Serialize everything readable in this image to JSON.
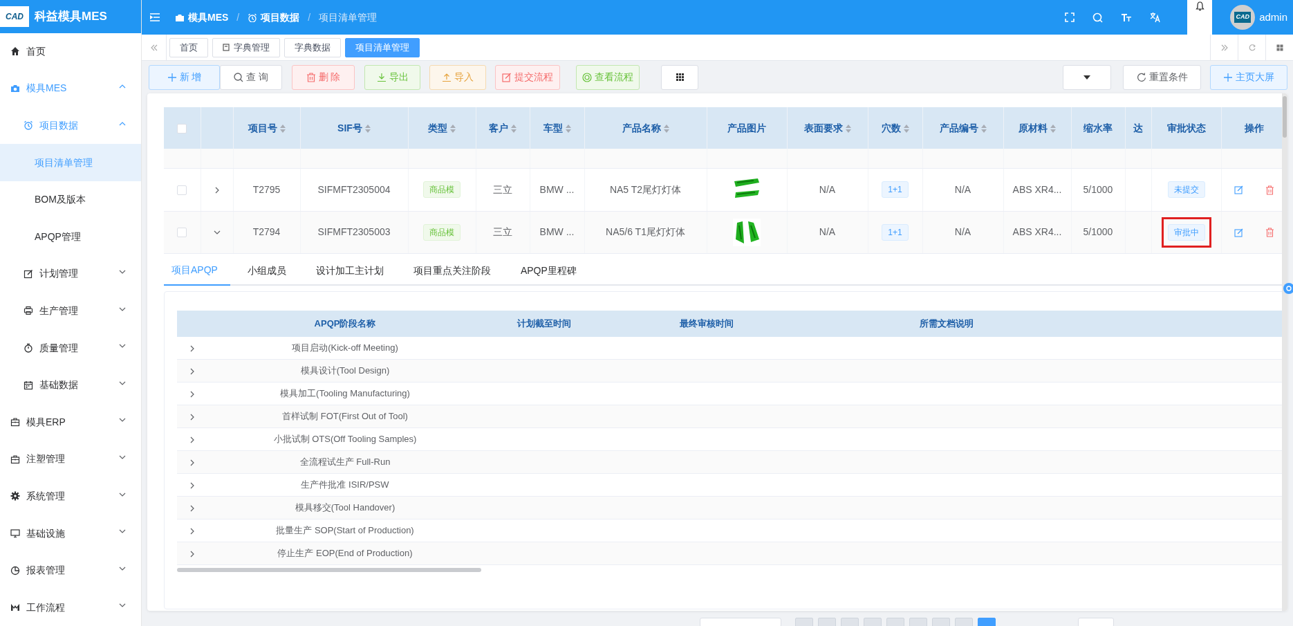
{
  "header": {
    "logo_text": "CAD",
    "app_title": "科益模具MES",
    "breadcrumb": [
      {
        "label": "模具MES",
        "current": false
      },
      {
        "separator": "/",
        "label": "项目数据",
        "current": false
      },
      {
        "separator": "/",
        "label": "项目清单管理",
        "current": true
      }
    ],
    "user": {
      "avatar_text": "CAD",
      "name": "admin"
    }
  },
  "sidebar": {
    "items": [
      {
        "label": "首页",
        "selected": false
      },
      {
        "label": "模具MES",
        "selected": false,
        "expanded": true,
        "children": [
          {
            "label": "项目数据",
            "selected": false,
            "expanded": true,
            "children": [
              {
                "label": "项目清单管理",
                "selected": true
              },
              {
                "label": "BOM及版本",
                "selected": false
              },
              {
                "label": "APQP管理",
                "selected": false
              }
            ]
          },
          {
            "label": "计划管理",
            "selected": false,
            "expanded": false
          },
          {
            "label": "生产管理",
            "selected": false,
            "expanded": false
          },
          {
            "label": "质量管理",
            "selected": false,
            "expanded": false
          },
          {
            "label": "基础数据",
            "selected": false,
            "expanded": false
          }
        ]
      },
      {
        "label": "模具ERP",
        "selected": false,
        "expanded": false
      },
      {
        "label": "注塑管理",
        "selected": false,
        "expanded": false
      },
      {
        "label": "系统管理",
        "selected": false,
        "expanded": false
      },
      {
        "label": "基础设施",
        "selected": false,
        "expanded": false
      },
      {
        "label": "报表管理",
        "selected": false,
        "expanded": false
      },
      {
        "label": "工作流程",
        "selected": false,
        "expanded": false
      }
    ]
  },
  "tabs": [
    {
      "label": "首页",
      "selected": false
    },
    {
      "label": "字典管理",
      "selected": false
    },
    {
      "label": "字典数据",
      "selected": false
    },
    {
      "label": "项目清单管理",
      "selected": true
    }
  ],
  "toolbar": {
    "buttons": [
      {
        "label": "新 增",
        "kind": "primary"
      },
      {
        "label": "查 询",
        "kind": "default"
      },
      {
        "label": "删 除",
        "kind": "danger"
      },
      {
        "label": "导出",
        "kind": "success"
      },
      {
        "label": "导入",
        "kind": "warning"
      },
      {
        "label": "提交流程",
        "kind": "danger"
      },
      {
        "label": "查看流程",
        "kind": "success"
      }
    ],
    "right_buttons": [
      {
        "label": "重置条件",
        "kind": "default"
      },
      {
        "label": "主页大屏",
        "kind": "primary"
      }
    ]
  },
  "table": {
    "all_checked": false,
    "columns": [
      {
        "label": "项目号",
        "sortable": true
      },
      {
        "label": "SIF号",
        "sortable": true
      },
      {
        "label": "类型",
        "sortable": true
      },
      {
        "label": "客户",
        "sortable": true
      },
      {
        "label": "车型",
        "sortable": true
      },
      {
        "label": "产品名称",
        "sortable": true
      },
      {
        "label": "产品图片",
        "sortable": false
      },
      {
        "label": "表面要求",
        "sortable": true
      },
      {
        "label": "穴数",
        "sortable": true
      },
      {
        "label": "产品编号",
        "sortable": true
      },
      {
        "label": "原材料",
        "sortable": true
      },
      {
        "label": "缩水率",
        "sortable": false
      },
      {
        "label": "达",
        "sortable": false
      },
      {
        "label": "审批状态",
        "sortable": false
      },
      {
        "label": "操作",
        "sortable": false
      }
    ],
    "rows": [
      {
        "checked": false,
        "expanded": false,
        "project_no": "T2795",
        "sif_no": "SIFMFT2305004",
        "type": "商品模",
        "customer": "三立",
        "car_model": "BMW ...",
        "product_name": "NA5 T2尾灯灯体",
        "surface": "N/A",
        "cavities": "1+1",
        "product_no": "N/A",
        "material": "ABS XR4...",
        "shrinkage": "5/1000",
        "status": "未提交",
        "highlighted": false
      },
      {
        "checked": false,
        "expanded": true,
        "project_no": "T2794",
        "sif_no": "SIFMFT2305003",
        "type": "商品模",
        "customer": "三立",
        "car_model": "BMW ...",
        "product_name": "NA5/6 T1尾灯灯体",
        "surface": "N/A",
        "cavities": "1+1",
        "product_no": "N/A",
        "material": "ABS XR4...",
        "shrinkage": "5/1000",
        "status": "审批中",
        "highlighted": true
      }
    ]
  },
  "detail_tabs": [
    {
      "label": "项目APQP",
      "selected": true
    },
    {
      "label": "小组成员",
      "selected": false
    },
    {
      "label": "设计加工主计划",
      "selected": false
    },
    {
      "label": "项目重点关注阶段",
      "selected": false
    },
    {
      "label": "APQP里程碑",
      "selected": false
    }
  ],
  "apqp_table": {
    "columns": [
      "APQP阶段名称",
      "计划截至时间",
      "最终审核时间",
      "所需文档说明"
    ],
    "rows": [
      {
        "stage": "项目启动(Kick-off Meeting)"
      },
      {
        "stage": "模具设计(Tool Design)"
      },
      {
        "stage": "模具加工(Tooling Manufacturing)"
      },
      {
        "stage": "首样试制 FOT(First Out of Tool)"
      },
      {
        "stage": "小批试制 OTS(Off Tooling Samples)"
      },
      {
        "stage": "全流程试生产 Full-Run"
      },
      {
        "stage": "生产件批准 ISIR/PSW"
      },
      {
        "stage": "模具移交(Tool Handover)"
      },
      {
        "stage": "批量生产 SOP(Start of Production)"
      },
      {
        "stage": "停止生产 EOP(End of Production)"
      }
    ]
  },
  "pagination": {
    "pages": [
      {
        "selected": false
      },
      {
        "selected": false
      },
      {
        "selected": false
      },
      {
        "selected": false
      },
      {
        "selected": false
      },
      {
        "selected": false
      },
      {
        "selected": false
      },
      {
        "selected": false
      },
      {
        "selected": true
      }
    ]
  }
}
